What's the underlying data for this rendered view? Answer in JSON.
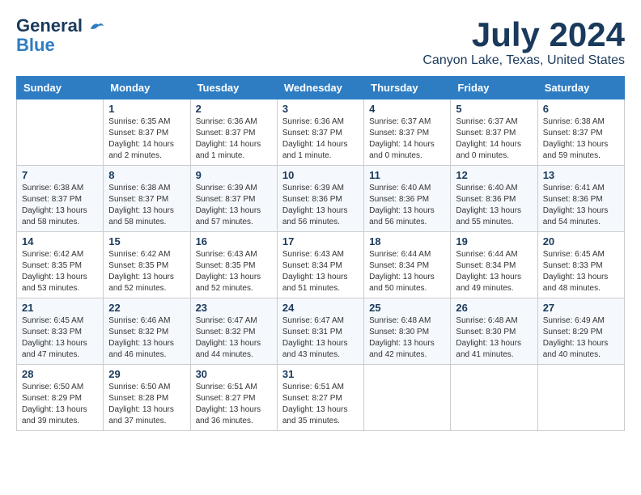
{
  "header": {
    "logo_general": "General",
    "logo_blue": "Blue",
    "month_title": "July 2024",
    "location": "Canyon Lake, Texas, United States"
  },
  "weekdays": [
    "Sunday",
    "Monday",
    "Tuesday",
    "Wednesday",
    "Thursday",
    "Friday",
    "Saturday"
  ],
  "weeks": [
    [
      {
        "day": "",
        "sunrise": "",
        "sunset": "",
        "daylight": ""
      },
      {
        "day": "1",
        "sunrise": "Sunrise: 6:35 AM",
        "sunset": "Sunset: 8:37 PM",
        "daylight": "Daylight: 14 hours and 2 minutes."
      },
      {
        "day": "2",
        "sunrise": "Sunrise: 6:36 AM",
        "sunset": "Sunset: 8:37 PM",
        "daylight": "Daylight: 14 hours and 1 minute."
      },
      {
        "day": "3",
        "sunrise": "Sunrise: 6:36 AM",
        "sunset": "Sunset: 8:37 PM",
        "daylight": "Daylight: 14 hours and 1 minute."
      },
      {
        "day": "4",
        "sunrise": "Sunrise: 6:37 AM",
        "sunset": "Sunset: 8:37 PM",
        "daylight": "Daylight: 14 hours and 0 minutes."
      },
      {
        "day": "5",
        "sunrise": "Sunrise: 6:37 AM",
        "sunset": "Sunset: 8:37 PM",
        "daylight": "Daylight: 14 hours and 0 minutes."
      },
      {
        "day": "6",
        "sunrise": "Sunrise: 6:38 AM",
        "sunset": "Sunset: 8:37 PM",
        "daylight": "Daylight: 13 hours and 59 minutes."
      }
    ],
    [
      {
        "day": "7",
        "sunrise": "Sunrise: 6:38 AM",
        "sunset": "Sunset: 8:37 PM",
        "daylight": "Daylight: 13 hours and 58 minutes."
      },
      {
        "day": "8",
        "sunrise": "Sunrise: 6:38 AM",
        "sunset": "Sunset: 8:37 PM",
        "daylight": "Daylight: 13 hours and 58 minutes."
      },
      {
        "day": "9",
        "sunrise": "Sunrise: 6:39 AM",
        "sunset": "Sunset: 8:37 PM",
        "daylight": "Daylight: 13 hours and 57 minutes."
      },
      {
        "day": "10",
        "sunrise": "Sunrise: 6:39 AM",
        "sunset": "Sunset: 8:36 PM",
        "daylight": "Daylight: 13 hours and 56 minutes."
      },
      {
        "day": "11",
        "sunrise": "Sunrise: 6:40 AM",
        "sunset": "Sunset: 8:36 PM",
        "daylight": "Daylight: 13 hours and 56 minutes."
      },
      {
        "day": "12",
        "sunrise": "Sunrise: 6:40 AM",
        "sunset": "Sunset: 8:36 PM",
        "daylight": "Daylight: 13 hours and 55 minutes."
      },
      {
        "day": "13",
        "sunrise": "Sunrise: 6:41 AM",
        "sunset": "Sunset: 8:36 PM",
        "daylight": "Daylight: 13 hours and 54 minutes."
      }
    ],
    [
      {
        "day": "14",
        "sunrise": "Sunrise: 6:42 AM",
        "sunset": "Sunset: 8:35 PM",
        "daylight": "Daylight: 13 hours and 53 minutes."
      },
      {
        "day": "15",
        "sunrise": "Sunrise: 6:42 AM",
        "sunset": "Sunset: 8:35 PM",
        "daylight": "Daylight: 13 hours and 52 minutes."
      },
      {
        "day": "16",
        "sunrise": "Sunrise: 6:43 AM",
        "sunset": "Sunset: 8:35 PM",
        "daylight": "Daylight: 13 hours and 52 minutes."
      },
      {
        "day": "17",
        "sunrise": "Sunrise: 6:43 AM",
        "sunset": "Sunset: 8:34 PM",
        "daylight": "Daylight: 13 hours and 51 minutes."
      },
      {
        "day": "18",
        "sunrise": "Sunrise: 6:44 AM",
        "sunset": "Sunset: 8:34 PM",
        "daylight": "Daylight: 13 hours and 50 minutes."
      },
      {
        "day": "19",
        "sunrise": "Sunrise: 6:44 AM",
        "sunset": "Sunset: 8:34 PM",
        "daylight": "Daylight: 13 hours and 49 minutes."
      },
      {
        "day": "20",
        "sunrise": "Sunrise: 6:45 AM",
        "sunset": "Sunset: 8:33 PM",
        "daylight": "Daylight: 13 hours and 48 minutes."
      }
    ],
    [
      {
        "day": "21",
        "sunrise": "Sunrise: 6:45 AM",
        "sunset": "Sunset: 8:33 PM",
        "daylight": "Daylight: 13 hours and 47 minutes."
      },
      {
        "day": "22",
        "sunrise": "Sunrise: 6:46 AM",
        "sunset": "Sunset: 8:32 PM",
        "daylight": "Daylight: 13 hours and 46 minutes."
      },
      {
        "day": "23",
        "sunrise": "Sunrise: 6:47 AM",
        "sunset": "Sunset: 8:32 PM",
        "daylight": "Daylight: 13 hours and 44 minutes."
      },
      {
        "day": "24",
        "sunrise": "Sunrise: 6:47 AM",
        "sunset": "Sunset: 8:31 PM",
        "daylight": "Daylight: 13 hours and 43 minutes."
      },
      {
        "day": "25",
        "sunrise": "Sunrise: 6:48 AM",
        "sunset": "Sunset: 8:30 PM",
        "daylight": "Daylight: 13 hours and 42 minutes."
      },
      {
        "day": "26",
        "sunrise": "Sunrise: 6:48 AM",
        "sunset": "Sunset: 8:30 PM",
        "daylight": "Daylight: 13 hours and 41 minutes."
      },
      {
        "day": "27",
        "sunrise": "Sunrise: 6:49 AM",
        "sunset": "Sunset: 8:29 PM",
        "daylight": "Daylight: 13 hours and 40 minutes."
      }
    ],
    [
      {
        "day": "28",
        "sunrise": "Sunrise: 6:50 AM",
        "sunset": "Sunset: 8:29 PM",
        "daylight": "Daylight: 13 hours and 39 minutes."
      },
      {
        "day": "29",
        "sunrise": "Sunrise: 6:50 AM",
        "sunset": "Sunset: 8:28 PM",
        "daylight": "Daylight: 13 hours and 37 minutes."
      },
      {
        "day": "30",
        "sunrise": "Sunrise: 6:51 AM",
        "sunset": "Sunset: 8:27 PM",
        "daylight": "Daylight: 13 hours and 36 minutes."
      },
      {
        "day": "31",
        "sunrise": "Sunrise: 6:51 AM",
        "sunset": "Sunset: 8:27 PM",
        "daylight": "Daylight: 13 hours and 35 minutes."
      },
      {
        "day": "",
        "sunrise": "",
        "sunset": "",
        "daylight": ""
      },
      {
        "day": "",
        "sunrise": "",
        "sunset": "",
        "daylight": ""
      },
      {
        "day": "",
        "sunrise": "",
        "sunset": "",
        "daylight": ""
      }
    ]
  ]
}
